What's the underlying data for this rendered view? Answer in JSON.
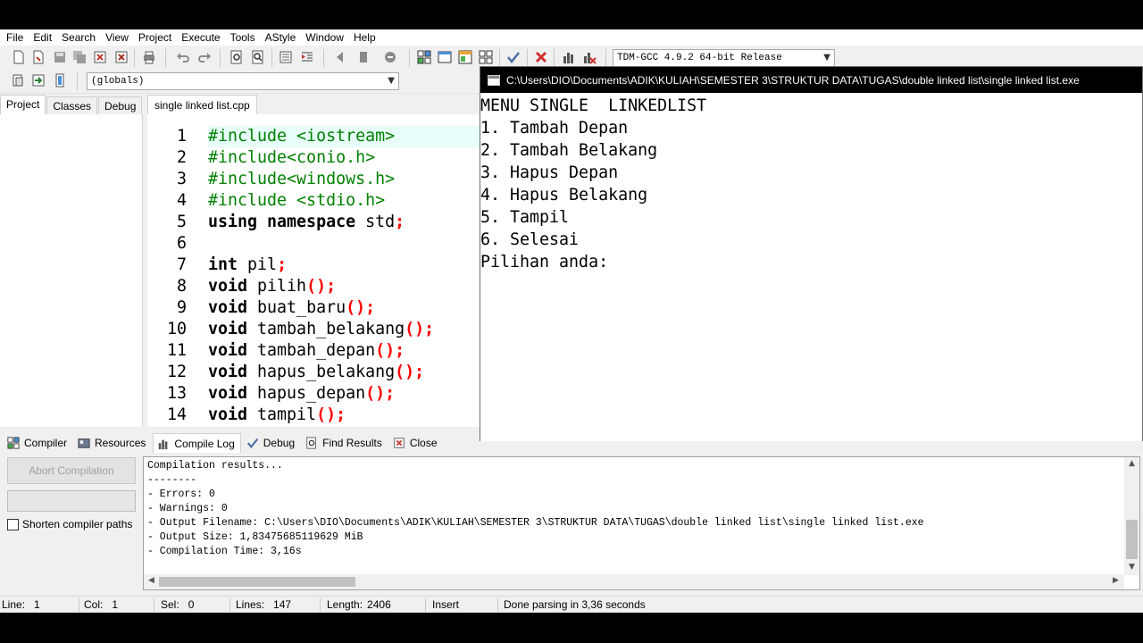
{
  "menu": [
    "File",
    "Edit",
    "Search",
    "View",
    "Project",
    "Execute",
    "Tools",
    "AStyle",
    "Window",
    "Help"
  ],
  "toolbar": {
    "compiler_select": "TDM-GCC 4.9.2 64-bit Release",
    "scope_select": "(globals)"
  },
  "left_tabs": [
    "Project",
    "Classes",
    "Debug"
  ],
  "editor": {
    "tab": "single linked list.cpp",
    "lines": [
      {
        "n": "1",
        "parts": [
          {
            "t": "#include <iostream>",
            "c": "pp"
          }
        ]
      },
      {
        "n": "2",
        "parts": [
          {
            "t": "#include<conio.h>",
            "c": "pp"
          }
        ]
      },
      {
        "n": "3",
        "parts": [
          {
            "t": "#include<windows.h>",
            "c": "pp"
          }
        ]
      },
      {
        "n": "4",
        "parts": [
          {
            "t": "#include <stdio.h>",
            "c": "pp"
          }
        ]
      },
      {
        "n": "5",
        "parts": [
          {
            "t": "using namespace",
            "c": "kw"
          },
          {
            "t": " std",
            "c": "id"
          },
          {
            "t": ";",
            "c": "pn"
          }
        ]
      },
      {
        "n": "6",
        "parts": []
      },
      {
        "n": "7",
        "parts": [
          {
            "t": "int",
            "c": "kw"
          },
          {
            "t": " pil",
            "c": "id"
          },
          {
            "t": ";",
            "c": "pn"
          }
        ]
      },
      {
        "n": "8",
        "parts": [
          {
            "t": "void",
            "c": "kw"
          },
          {
            "t": " pilih",
            "c": "id"
          },
          {
            "t": "();",
            "c": "pn"
          }
        ]
      },
      {
        "n": "9",
        "parts": [
          {
            "t": "void",
            "c": "kw"
          },
          {
            "t": " buat_baru",
            "c": "id"
          },
          {
            "t": "();",
            "c": "pn"
          }
        ]
      },
      {
        "n": "10",
        "parts": [
          {
            "t": "void",
            "c": "kw"
          },
          {
            "t": " tambah_belakang",
            "c": "id"
          },
          {
            "t": "();",
            "c": "pn"
          }
        ]
      },
      {
        "n": "11",
        "parts": [
          {
            "t": "void",
            "c": "kw"
          },
          {
            "t": " tambah_depan",
            "c": "id"
          },
          {
            "t": "();",
            "c": "pn"
          }
        ]
      },
      {
        "n": "12",
        "parts": [
          {
            "t": "void",
            "c": "kw"
          },
          {
            "t": " hapus_belakang",
            "c": "id"
          },
          {
            "t": "();",
            "c": "pn"
          }
        ]
      },
      {
        "n": "13",
        "parts": [
          {
            "t": "void",
            "c": "kw"
          },
          {
            "t": " hapus_depan",
            "c": "id"
          },
          {
            "t": "();",
            "c": "pn"
          }
        ]
      },
      {
        "n": "14",
        "parts": [
          {
            "t": "void",
            "c": "kw"
          },
          {
            "t": " tampil",
            "c": "id"
          },
          {
            "t": "();",
            "c": "pn"
          }
        ]
      }
    ]
  },
  "console": {
    "title": "C:\\Users\\DIO\\Documents\\ADIK\\KULIAH\\SEMESTER 3\\STRUKTUR DATA\\TUGAS\\double linked list\\single linked list.exe",
    "lines": [
      "MENU SINGLE  LINKEDLIST",
      "1. Tambah Depan",
      "2. Tambah Belakang",
      "3. Hapus Depan",
      "4. Hapus Belakang",
      "5. Tampil",
      "6. Selesai",
      "Pilihan anda:"
    ]
  },
  "bottom_tabs": [
    "Compiler",
    "Resources",
    "Compile Log",
    "Debug",
    "Find Results",
    "Close"
  ],
  "compile": {
    "abort_label": "Abort Compilation",
    "shorten_label": "Shorten compiler paths",
    "log": [
      "Compilation results...",
      "--------",
      "- Errors: 0",
      "- Warnings: 0",
      "- Output Filename: C:\\Users\\DIO\\Documents\\ADIK\\KULIAH\\SEMESTER 3\\STRUKTUR DATA\\TUGAS\\double linked list\\single linked list.exe",
      "- Output Size: 1,83475685119629 MiB",
      "- Compilation Time: 3,16s"
    ]
  },
  "status": {
    "line_label": "Line:",
    "line_value": "1",
    "col_label": "Col:",
    "col_value": "1",
    "sel_label": "Sel:",
    "sel_value": "0",
    "lines_label": "Lines:",
    "lines_value": "147",
    "length_label": "Length:",
    "length_value": "2406",
    "mode": "Insert",
    "message": "Done parsing in 3,36 seconds"
  }
}
